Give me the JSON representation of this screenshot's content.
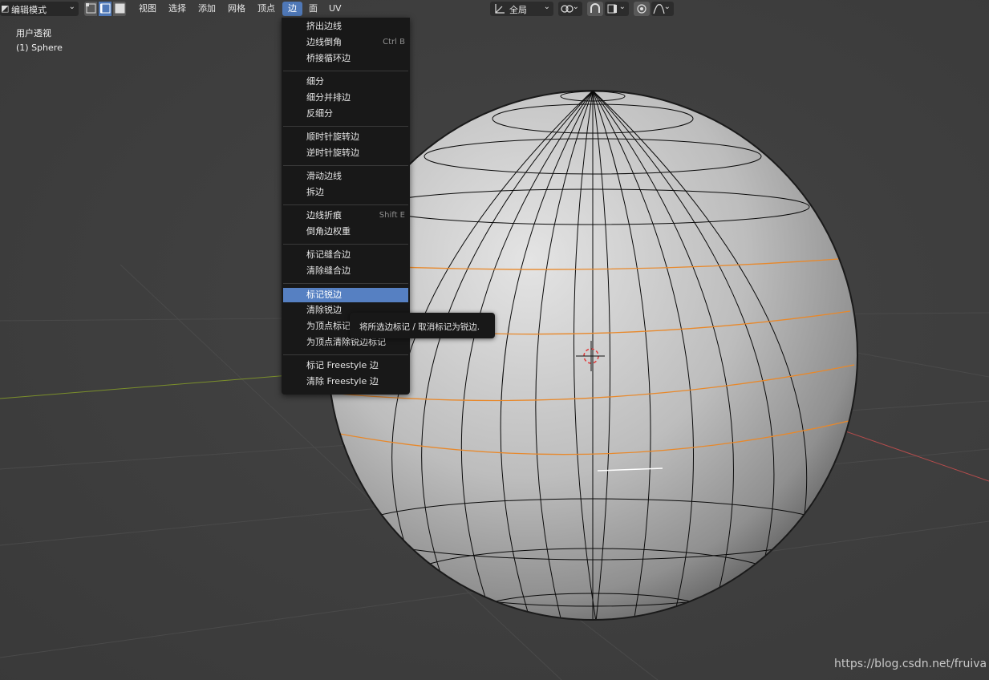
{
  "header": {
    "mode_label": "编辑模式",
    "menus": [
      {
        "label": "视图"
      },
      {
        "label": "选择"
      },
      {
        "label": "添加"
      },
      {
        "label": "网格"
      },
      {
        "label": "顶点"
      },
      {
        "label": "边"
      },
      {
        "label": "面"
      },
      {
        "label": "UV"
      }
    ],
    "active_menu": "边",
    "transform_orientation": "全局",
    "select_mode_active": "edge"
  },
  "viewport": {
    "view_name": "用户透视",
    "object_name": "(1) Sphere"
  },
  "edge_menu": {
    "items": [
      {
        "label": "挤出边线",
        "shortcut": ""
      },
      {
        "label": "边线倒角",
        "shortcut": "Ctrl B"
      },
      {
        "label": "桥接循环边",
        "shortcut": ""
      },
      {
        "label": "细分",
        "shortcut": ""
      },
      {
        "label": "细分并排边",
        "shortcut": ""
      },
      {
        "label": "反细分",
        "shortcut": ""
      },
      {
        "label": "顺时针旋转边",
        "shortcut": ""
      },
      {
        "label": "逆时针旋转边",
        "shortcut": ""
      },
      {
        "label": "滑动边线",
        "shortcut": ""
      },
      {
        "label": "拆边",
        "shortcut": ""
      },
      {
        "label": "边线折痕",
        "shortcut": "Shift E"
      },
      {
        "label": "倒角边权重",
        "shortcut": ""
      },
      {
        "label": "标记缝合边",
        "shortcut": ""
      },
      {
        "label": "清除缝合边",
        "shortcut": ""
      },
      {
        "label": "标记锐边",
        "shortcut": ""
      },
      {
        "label": "清除锐边",
        "shortcut": ""
      },
      {
        "label": "为顶点标记锐边",
        "shortcut": ""
      },
      {
        "label": "为顶点清除锐边标记",
        "shortcut": ""
      },
      {
        "label": "标记 Freestyle 边",
        "shortcut": ""
      },
      {
        "label": "清除 Freestyle 边",
        "shortcut": ""
      }
    ],
    "highlighted": "标记锐边",
    "tooltip": "将所选边标记 / 取消标记为锐边."
  },
  "watermark": "https://blog.csdn.net/fruiva",
  "colors": {
    "background": "#3d3d3d",
    "header_accent": "#4f78b7",
    "menu_highlight": "#5680c2",
    "seam_edges": "#e8882a",
    "axis_x": "#b44c4c",
    "axis_y": "#7b8f2b",
    "sphere": "#b9b9b9"
  }
}
